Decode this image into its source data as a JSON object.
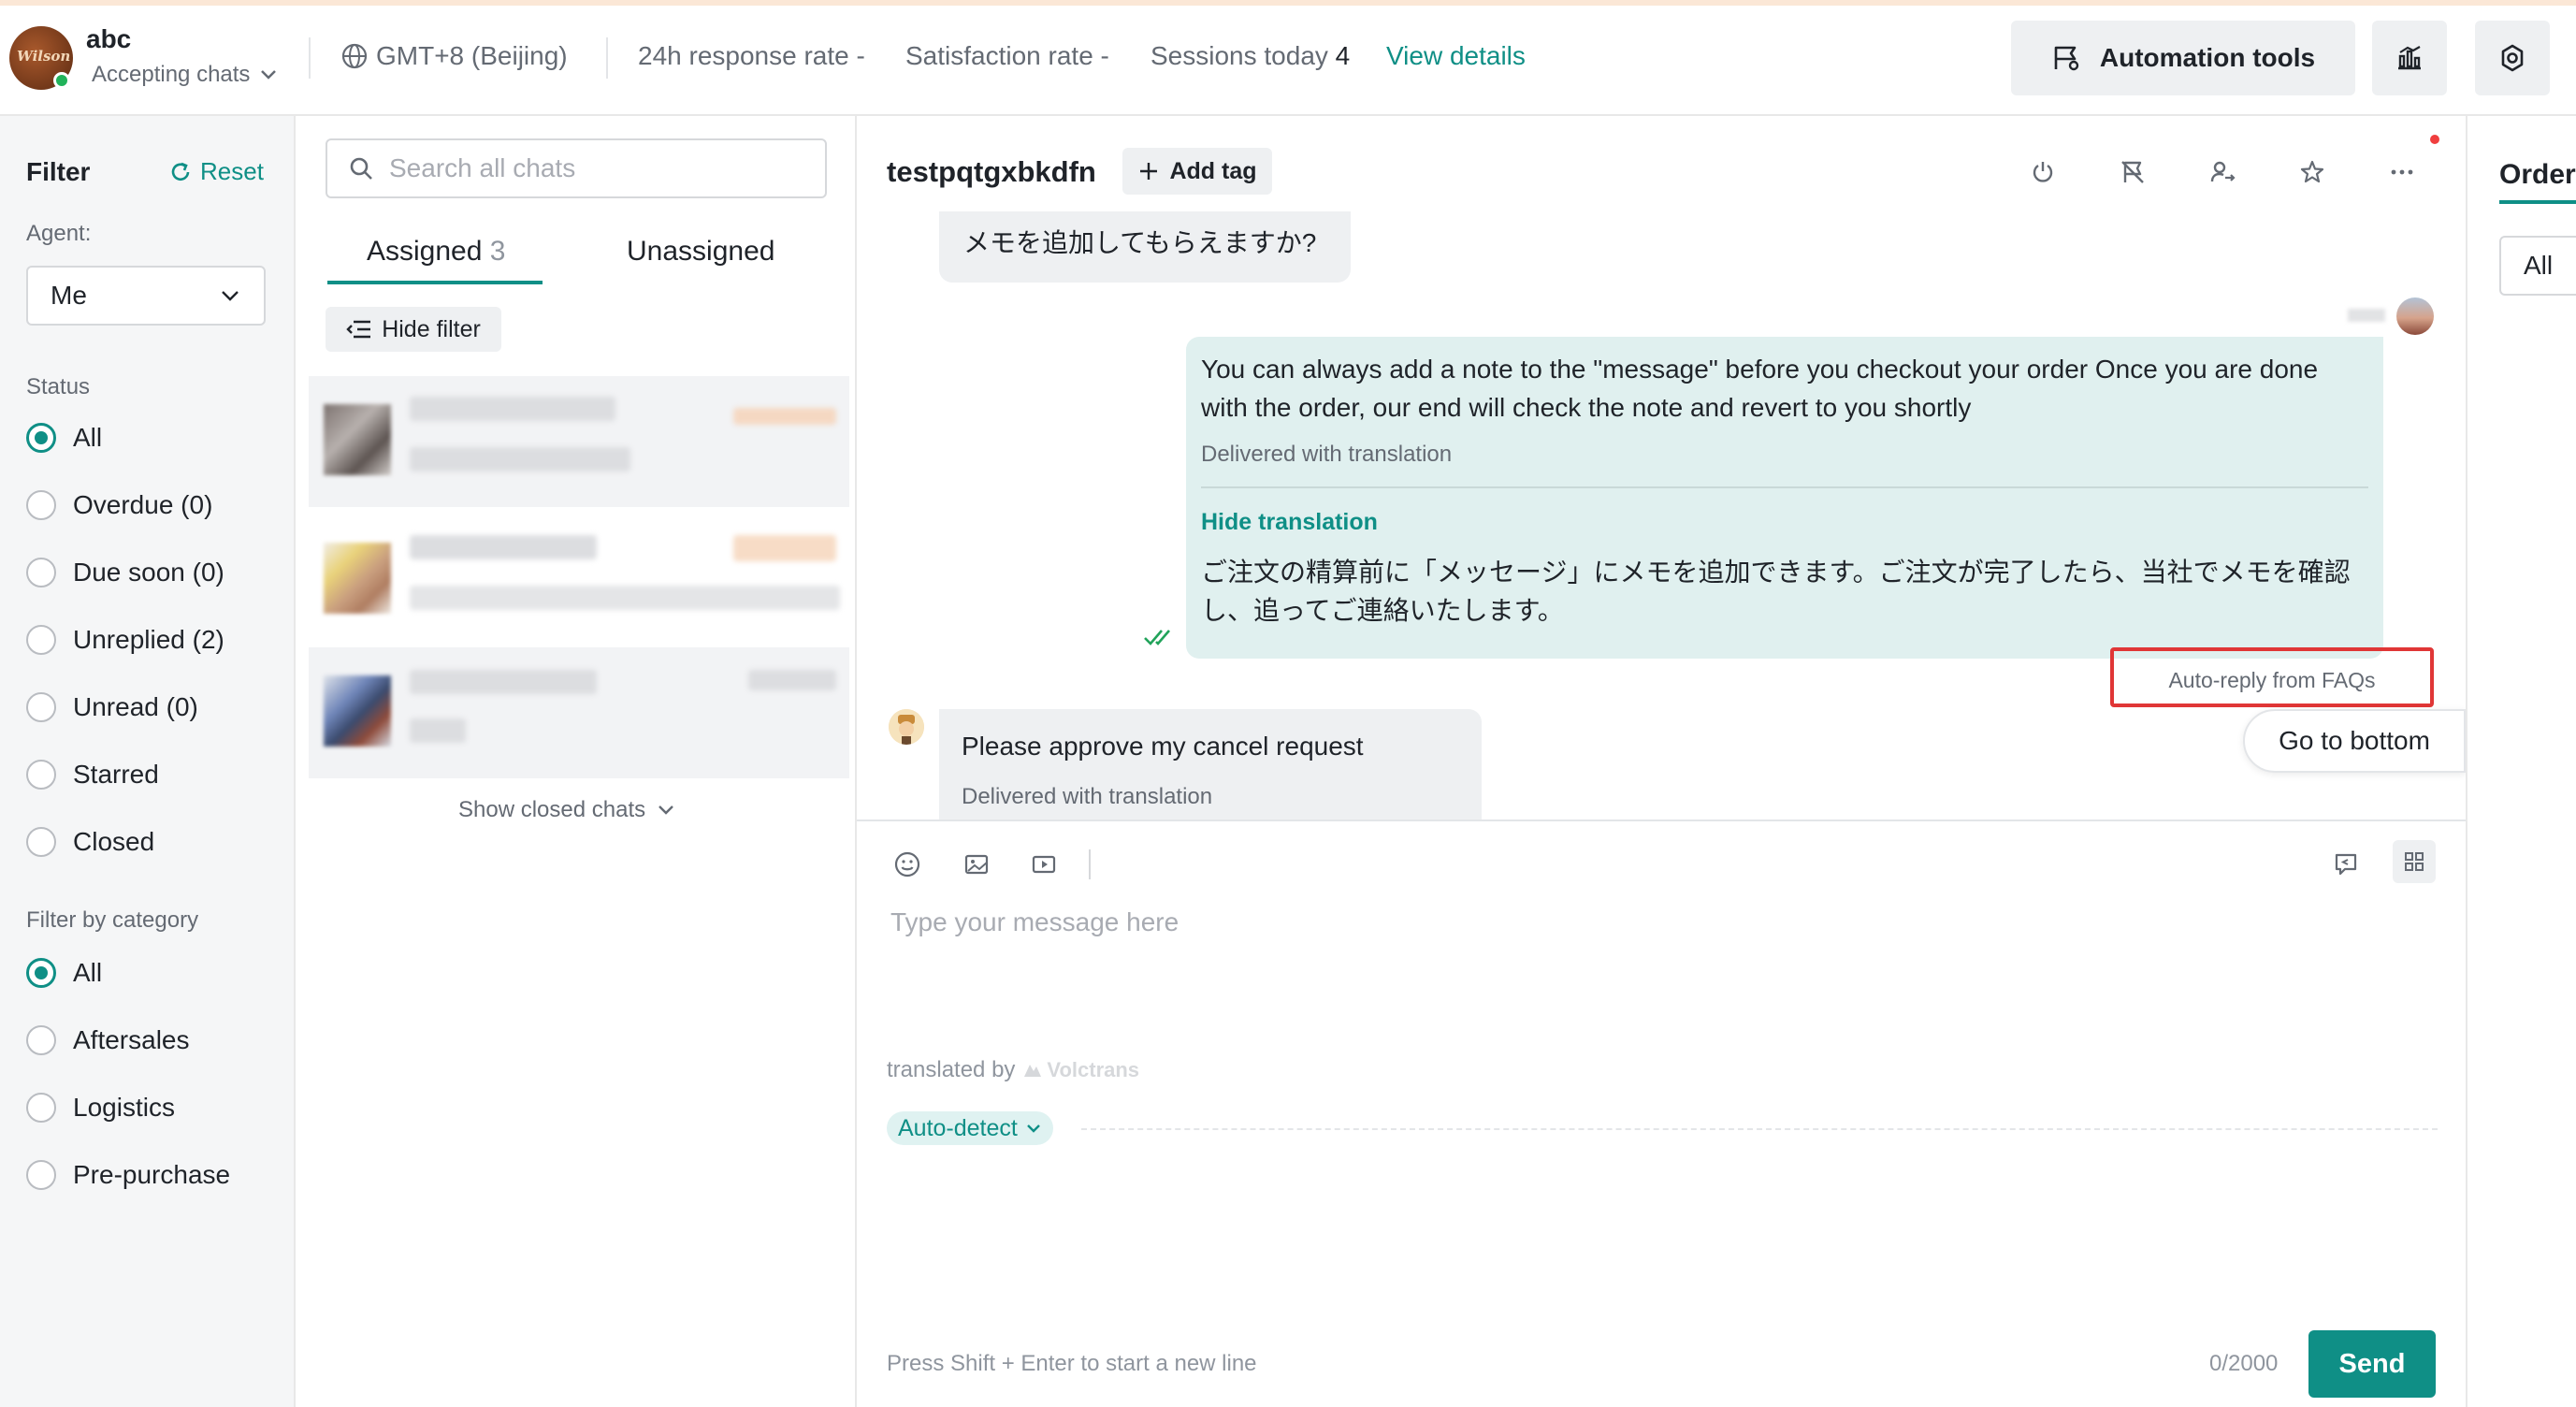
{
  "header": {
    "username": "abc",
    "avatar_text": "Wilson",
    "status": "Accepting chats",
    "timezone": "GMT+8 (Beijing)",
    "response_rate_label": "24h response rate -",
    "satisfaction_label": "Satisfaction rate -",
    "sessions_label": "Sessions today",
    "sessions_value": "4",
    "view_details": "View details",
    "automation_tools": "Automation tools"
  },
  "filter": {
    "title": "Filter",
    "reset": "Reset",
    "agent_label": "Agent:",
    "agent_value": "Me",
    "status_label": "Status",
    "status_options": [
      "All",
      "Overdue (0)",
      "Due soon (0)",
      "Unreplied (2)",
      "Unread (0)",
      "Starred",
      "Closed"
    ],
    "status_selected": "All",
    "category_label": "Filter by category",
    "category_options": [
      "All",
      "Aftersales",
      "Logistics",
      "Pre-purchase"
    ],
    "category_selected": "All"
  },
  "chat_list": {
    "search_placeholder": "Search all chats",
    "tab_assigned": "Assigned",
    "tab_assigned_count": "3",
    "tab_unassigned": "Unassigned",
    "hide_filter": "Hide filter",
    "show_closed": "Show closed chats"
  },
  "conversation": {
    "title": "testpqtgxbkdfn",
    "add_tag": "Add tag",
    "messages": {
      "top_partial": "メモを追加してもらえますか?",
      "outgoing_text": "You can always add a note to the \"message\" before you checkout your order Once you are done with the order, our end will check the note and revert to you shortly",
      "outgoing_delivered": "Delivered with translation",
      "hide_translation": "Hide translation",
      "outgoing_translation": "ご注文の精算前に「メッセージ」にメモを追加できます。ご注文が完了したら、当社でメモを確認し、追ってご連絡いたします。",
      "auto_reply_label": "Auto-reply from FAQs",
      "incoming_text": "Please approve my cancel request",
      "incoming_delivered": "Delivered with translation"
    },
    "go_bottom": "Go to bottom"
  },
  "composer": {
    "placeholder": "Type your message here",
    "translated_by": "translated by",
    "translator": "Volctrans",
    "language": "Auto-detect",
    "hint": "Press Shift + Enter to start a new line",
    "counter": "0/2000",
    "send": "Send"
  },
  "right_panel": {
    "tab": "Orders",
    "filter_value": "All"
  },
  "colors": {
    "accent": "#0f8f86",
    "outgoing_bubble": "#e0f0ef",
    "highlight_box": "#e03636"
  }
}
